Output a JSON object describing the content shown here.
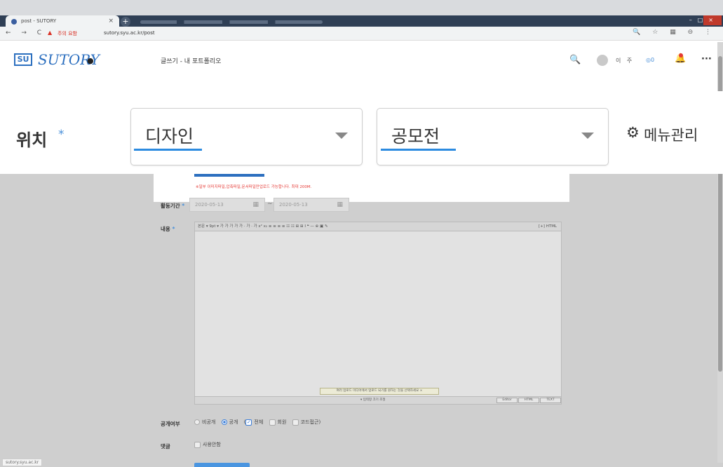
{
  "browser": {
    "tab_title": "post - SUTORY",
    "tab_close": "×",
    "new_tab": "+",
    "nav_icons": "← → C",
    "security_icon": "▲",
    "security_text": "주의 요함",
    "url": "sutory.syu.ac.kr/post",
    "right_icons": "🔍 ☆ ▦ ⊖ ⋮",
    "window_buttons": "–□×",
    "status_url": "sutory.syu.ac.kr"
  },
  "header": {
    "logo_box": "SU",
    "logo_text": "SUTORY",
    "chat_icon": "●",
    "search_icon": "🔍",
    "username": "이 주",
    "coin": "◎0",
    "bell_icon": "🔔",
    "more_icon": "···"
  },
  "page": {
    "heading": "글쓰기 - 내 포트폴리오"
  },
  "location": {
    "label": "위치",
    "required_mark": "*",
    "category_value": "디자인",
    "subcategory_value": "공모전",
    "menu_manage_icon": "⚙",
    "menu_manage_label": "메뉴관리"
  },
  "upload": {
    "note": "※일부 이미지파일,압축파일,문서파일만업로드 가능합니다. 최대 200M."
  },
  "period": {
    "label": "활동기간",
    "required_mark": "*",
    "start_date": "2020-05-13",
    "end_date": "2020-05-13",
    "separator": "~",
    "calendar_icon": "▦"
  },
  "content": {
    "label": "내용",
    "required_mark": "*",
    "toolbar_left": "본문 ▾  9pt ▾  가 가 가 가 가 · 가 · 가 x² x₂  ≡ ≡ ≡ ≡ ☷ ☷ ⊞ ⊞ I  ❝  — ⊕ ▣ ✎",
    "toolbar_right": "[+] HTML",
    "hint": "여러 업로드 미디어에서 업로드 되기를 원하는 것을 선택하세요 ×",
    "resize_text": "▾ 입력창 크기 조절",
    "editor_buttons": [
      "Editor",
      "HTML",
      "TEXT"
    ]
  },
  "visibility": {
    "label": "공개여부",
    "options": [
      "비공개",
      "공개"
    ],
    "selected": "공개",
    "scope_options": [
      "전체",
      "회원",
      "코드접근"
    ],
    "scope_checked": "전체",
    "close_paren": ")"
  },
  "comment": {
    "label": "댓글",
    "option": "사용안함"
  }
}
